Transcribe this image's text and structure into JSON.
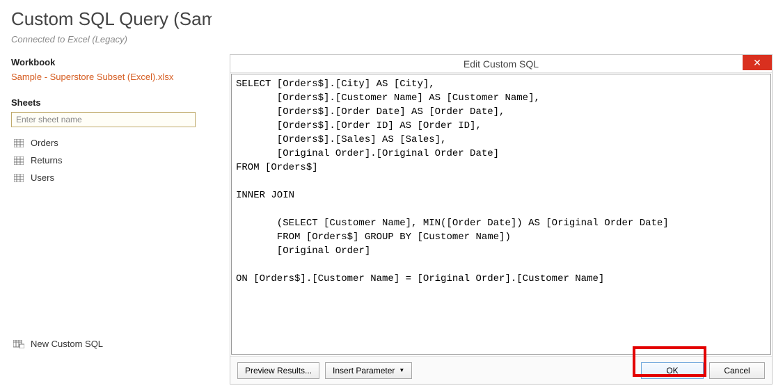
{
  "page": {
    "title": "Custom SQL Query (Sample - Superst...",
    "connected": "Connected to Excel (Legacy)"
  },
  "workbook": {
    "heading": "Workbook",
    "file": "Sample - Superstore Subset (Excel).xlsx"
  },
  "sheets": {
    "heading": "Sheets",
    "placeholder": "Enter sheet name",
    "items": [
      "Orders",
      "Returns",
      "Users"
    ]
  },
  "newCustom": "New Custom SQL",
  "modal": {
    "title": "Edit Custom SQL",
    "sql": "SELECT [Orders$].[City] AS [City],\n       [Orders$].[Customer Name] AS [Customer Name],\n       [Orders$].[Order Date] AS [Order Date],\n       [Orders$].[Order ID] AS [Order ID],\n       [Orders$].[Sales] AS [Sales],\n       [Original Order].[Original Order Date]\nFROM [Orders$]\n\nINNER JOIN\n\n       (SELECT [Customer Name], MIN([Order Date]) AS [Original Order Date]\n       FROM [Orders$] GROUP BY [Customer Name])\n       [Original Order]\n\nON [Orders$].[Customer Name] = [Original Order].[Customer Name]",
    "buttons": {
      "preview": "Preview Results...",
      "insertParam": "Insert Parameter",
      "ok": "OK",
      "cancel": "Cancel"
    }
  }
}
